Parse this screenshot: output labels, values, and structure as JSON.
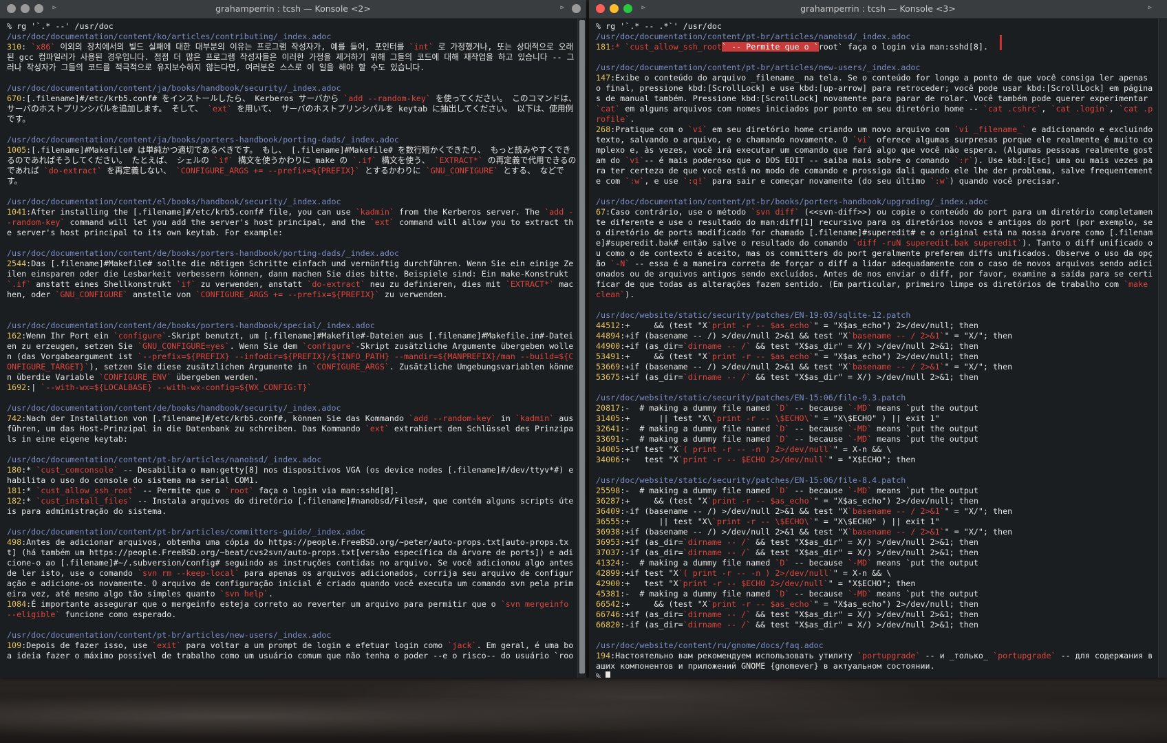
{
  "left_window": {
    "title": "grahamperrin : tcsh — Konsole <2>",
    "lines": [
      {
        "t": "prompt",
        "s": "% rg '`.* --' /usr/doc"
      },
      {
        "t": "path",
        "s": "/usr/doc/documentation/content/ko/articles/contributing/_index.adoc"
      },
      {
        "t": "match",
        "n": "310",
        "s": ": `x86` 이외의 장치에서의 빌드 실패에 대한 대부분의 이유는 프로그램 작성자가, 예를 들어, 포인터를 `int` 로 가정했거나, 또는 상대적으로 오래된 gcc 컴파일러가 사용된 경우입니다. 점점 더 많은 프로그램 작성자들은 이러한 가정을 제거하기 위해 그들의 코드에 대해 재작업을 하고 있습니다 -- 그러나 작성자가 그들의 코드를 적극적으로 유지보수하지 않는다면, 여러분은 스스로 이 일을 해야 할 수도 있습니다."
      },
      {
        "t": "blank",
        "s": ""
      },
      {
        "t": "path",
        "s": "/usr/doc/documentation/content/ja/books/handbook/security/_index.adoc"
      },
      {
        "t": "match",
        "n": "670",
        "s": ":[.filename]#/etc/krb5.conf# をインストールしたら、 Kerberos サーバから `add --random-key` を使ってください。 このコマンドは、サーバのホストプリンシパルを追加します。 そして、 `ext` を用いて、 サーバのホストプリンシパルを keytab に抽出してください。 以下は、使用例です。"
      },
      {
        "t": "blank",
        "s": ""
      },
      {
        "t": "path",
        "s": "/usr/doc/documentation/content/ja/books/porters-handbook/porting-dads/_index.adoc"
      },
      {
        "t": "match",
        "n": "1005",
        "s": ":[.filename]#Makefile# は単純かつ適切であるべきです。 もし、 [.filename]#Makefile# を数行短かくできたり、 もっと読みやすくできるのであればそうしてください。 たとえば、 シェルの `if` 構文を使うかわりに make の `.if` 構文を使う、 `EXTRACT*` の再定義で代用できるのであれば `do-extract` を再定義しない、 `CONFIGURE_ARGS += --prefix=${PREFIX}` とするかわりに `GNU_CONFIGURE` とする、 などです。"
      },
      {
        "t": "blank",
        "s": ""
      },
      {
        "t": "path",
        "s": "/usr/doc/documentation/content/el/books/handbook/security/_index.adoc"
      },
      {
        "t": "match",
        "n": "1041",
        "s": ":After installing the [.filename]#/etc/krb5.conf# file, you can use `kadmin` from the Kerberos server. The `add --random-key` command will let you add the server's host principal, and the `ext` command will allow you to extract the server's host principal to its own keytab. For example:"
      },
      {
        "t": "blank",
        "s": ""
      },
      {
        "t": "path",
        "s": "/usr/doc/documentation/content/de/books/porters-handbook/porting-dads/_index.adoc"
      },
      {
        "t": "match",
        "n": "2544",
        "s": ":Das [.filename]#Makefile# sollte die nötigen Schritte einfach und vernünftig durchführen. Wenn Sie ein einige Zeilen einsparen oder die Lesbarkeit verbessern können, dann machen Sie dies bitte. Beispiele sind: Ein make-Konstrukt `.if` anstatt eines Shellkonstrukt `if` zu verwenden, anstatt `do-extract` neu zu definieren, dies mit `EXTRACT*` machen, oder `GNU_CONFIGURE` anstelle von `CONFIGURE_ARGS += --prefix=${PREFIX}` zu verwenden."
      },
      {
        "t": "blank",
        "s": ""
      },
      {
        "t": "blank",
        "s": ""
      },
      {
        "t": "path",
        "s": "/usr/doc/documentation/content/de/books/porters-handbook/special/_index.adoc"
      },
      {
        "t": "match",
        "n": "162",
        "s": ":Wenn Ihr Port ein `configure`-Skript benutzt, um [.filename]#Makefile#-Dateien aus [.filename]#Makefile.in#-Dateien zu erzeugen, setzen Sie `GNU_CONFIGURE=yes`. Wenn Sie dem `configure`-Skript zusätzliche Argumente übergeben wollen (das Vorgabeargument ist `--prefix=${PREFIX} --infodir=${PREFIX}/${INFO_PATH} --mandir=${MANPREFIX}/man --build=${CONFIGURE_TARGET}`), setzen Sie diese zusätzlichen Argumente in `CONFIGURE_ARGS`. Zusätzliche Umgebungsvariablen können überdie Variable `CONFIGURE_ENV` übergeben werden."
      },
      {
        "t": "match",
        "n": "1692",
        "s": ":| `--with-wx=${LOCALBASE} --with-wx-config=${WX_CONFIG:T}`"
      },
      {
        "t": "blank",
        "s": ""
      },
      {
        "t": "path",
        "s": "/usr/doc/documentation/content/de/books/handbook/security/_index.adoc"
      },
      {
        "t": "match",
        "n": "742",
        "s": ":Nach der Installation von [.filename]#/etc/krb5.conf#, können Sie das Kommando `add --random-key` in `kadmin` ausführen, um das Host-Prinzipal in die Datenbank zu schreiben. Das Kommando `ext` extrahiert den Schlüssel des Prinzipals in eine eigene keytab:"
      },
      {
        "t": "blank",
        "s": ""
      },
      {
        "t": "path",
        "s": "/usr/doc/documentation/content/pt-br/articles/nanobsd/_index.adoc"
      },
      {
        "t": "match",
        "n": "180",
        "s": ":* `cust_comconsole` -- Desabilita o man:getty[8] nos dispositivos VGA (os device nodes [.filename]#/dev/ttyv*#) e habilita o uso do console do sistema na serial COM1."
      },
      {
        "t": "match",
        "n": "181",
        "s": ":* `cust_allow_ssh_root` -- Permite que o `root` faça o login via man:sshd[8]."
      },
      {
        "t": "match",
        "n": "182",
        "s": ":* `cust_install_files` -- Instala arquivos do diretório [.filename]#nanobsd/Files#, que contém alguns scripts úteis para administração do sistema."
      },
      {
        "t": "blank",
        "s": ""
      },
      {
        "t": "path",
        "s": "/usr/doc/documentation/content/pt-br/articles/committers-guide/_index.adoc"
      },
      {
        "t": "match",
        "n": "498",
        "s": ":Antes de adicionar arquivos, obtenha uma cópia do https://people.FreeBSD.org/~peter/auto-props.txt[auto-props.txt] (há também um https://people.FreeBSD.org/~beat/cvs2svn/auto-props.txt[versão específica da árvore de ports]) e adicione-o ao [.filename]#~/.subversion/config# seguindo as instruções contidas no arquivo. Se você adicionou algo antes de ler isto, use o comando `svn rm --keep-local` para apenas os arquivos adicionados, corrija seu arquivo de configuração e adicione-os novamente. O arquivo de configuração inicial é criado quando você executa um comando svn pela primeira vez, até mesmo algo tão simples quanto `svn help`."
      },
      {
        "t": "match",
        "n": "1084",
        "s": ":É importante assegurar que o mergeinfo esteja correto ao reverter um arquivo para permitir que o `svn mergeinfo --eligible` funcione como esperado."
      },
      {
        "t": "blank",
        "s": ""
      },
      {
        "t": "path",
        "s": "/usr/doc/documentation/content/pt-br/articles/new-users/_index.adoc"
      },
      {
        "t": "match",
        "n": "109",
        "s": ":Depois de fazer isso, use `exit` para voltar a um prompt de login e efetuar login como `jack`. Em geral, é uma boa ideia fazer o máximo possível de trabalho como um usuário comum que não tenha o poder --e o risco-- do usuário `roo"
      }
    ]
  },
  "right_window": {
    "title": "grahamperrin : tcsh — Konsole <3>",
    "lines": [
      {
        "t": "prompt",
        "s": "% rg '`.* -- .*`' /usr/doc"
      },
      {
        "t": "path",
        "s": "/usr/doc/documentation/content/pt-br/articles/nanobsd/_index.adoc"
      },
      {
        "t": "sel",
        "n": "181",
        "a": ":* `cust_allow_ssh_root",
        "b": "` -- Permite que o `",
        "c": "root` faça o login via man:sshd[8]."
      },
      {
        "t": "blank",
        "s": ""
      },
      {
        "t": "path",
        "s": "/usr/doc/documentation/content/pt-br/articles/new-users/_index.adoc"
      },
      {
        "t": "match",
        "n": "147",
        "s": ":Exibe o conteúdo do arquivo _filename_ na tela. Se o conteúdo for longo a ponto de que você consiga ler apenas o final, pressione kbd:[ScrollLock] e use kbd:[up-arrow] para retroceder; você pode usar kbd:[ScrollLock] em páginas de manual também. Pressione kbd:[ScrollLock] novamente para parar de rolar. Você também pode querer experimentar `cat` em alguns arquivos com nomes iniciados por ponto em seu diretório home -- `cat .cshrc`, `cat .login`, `cat .profile`."
      },
      {
        "t": "match",
        "n": "268",
        "s": ":Pratique com o `vi` em seu diretório home criando um novo arquivo com `vi _filename_` e adicionando e excluindo texto, salvando o arquivo, e o chamando novamente. O `vi` oferece algumas surpresas porque ele realmente é muito complexo e, às vezes, você irá executar um comando que fará algo que você não espera. (Algumas pessoas realmente gostam do `vi`-- é mais poderoso que o DOS EDIT -- saiba mais sobre o comando `:r`). Use kbd:[Esc] uma ou mais vezes para ter certeza de que você está no modo de comando e prossiga dali quando ele lhe der problema, salve frequentemente com `:w`, e use `:q!` para sair e começar novamente (do seu último `:w`) quando você precisar."
      },
      {
        "t": "blank",
        "s": ""
      },
      {
        "t": "path",
        "s": "/usr/doc/documentation/content/pt-br/books/porters-handbook/upgrading/_index.adoc"
      },
      {
        "t": "match",
        "n": "67",
        "s": ":Caso contrário, use o método `svn diff` (<<svn-diff>>) ou copie o conteúdo do port para um diretório completamente diferente e use o resultado do man:diff[1] recursivo para os diretórios novos e antigos do port (por exemplo, se o diretório de ports modificado for chamado [.filename]#superedit# e o original está na nossa árvore como [.filename]#superedit.bak# então salve o resultado do comando `diff -ruN superedit.bak superedit`). Tanto o diff unificado ou como o de contexto é aceito, mas os committers do port geralmente preferem diffs unificados. Observe o uso da opção `-N` -- essa é a maneira correta de forçar o diff a lidar adequadamente com o caso de novos arquivos sendo adicionados ou de arquivos antigos sendo excluídos. Antes de nos enviar o diff, por favor, examine a saída para se certificar de que todas as alterações fazem sentido. (Em particular, primeiro limpe os diretórios de trabalho com `make clean`)."
      },
      {
        "t": "blank",
        "s": ""
      },
      {
        "t": "path",
        "s": "/usr/doc/website/static/security/patches/EN-19:03/sqlite-12.patch"
      },
      {
        "t": "match",
        "n": "44512",
        "s": ":+     && (test \"X`print -r -- $as_echo`\" = \"X$as_echo\") 2>/dev/null; then"
      },
      {
        "t": "match",
        "n": "44894",
        "s": ":+if (basename -- /) >/dev/null 2>&1 && test \"X`basename -- / 2>&1`\" = \"X/\"; then"
      },
      {
        "t": "match",
        "n": "44900",
        "s": ":+if (as_dir=`dirname -- /` && test \"X$as_dir\" = X/) >/dev/null 2>&1; then"
      },
      {
        "t": "match",
        "n": "53491",
        "s": ":+     && (test \"X`print -r -- $as_echo`\" = \"X$as_echo\") 2>/dev/null; then"
      },
      {
        "t": "match",
        "n": "53669",
        "s": ":+if (basename -- /) >/dev/null 2>&1 && test \"X`basename -- / 2>&1`\" = \"X/\"; then"
      },
      {
        "t": "match",
        "n": "53675",
        "s": ":+if (as_dir=`dirname -- /` && test \"X$as_dir\" = X/) >/dev/null 2>&1; then"
      },
      {
        "t": "blank",
        "s": ""
      },
      {
        "t": "path",
        "s": "/usr/doc/website/static/security/patches/EN-15:06/file-9.3.patch"
      },
      {
        "t": "match",
        "n": "20817",
        "s": ":-  # making a dummy file named `D` -- because `-MD` means `put the output"
      },
      {
        "t": "match",
        "n": "31405",
        "s": ":+      || test \"X\\`print -r -- \\$ECHO\\`\" = \"X\\$ECHO\" ) || exit 1\""
      },
      {
        "t": "match",
        "n": "32641",
        "s": ":-  # making a dummy file named `D` -- because `-MD` means `put the output"
      },
      {
        "t": "match",
        "n": "33691",
        "s": ":-  # making a dummy file named `D` -- because `-MD` means `put the output"
      },
      {
        "t": "match",
        "n": "34005",
        "s": ":+if test \"X`( print -r -- -n ) 2>/dev/null`\" = X-n && \\"
      },
      {
        "t": "match",
        "n": "34006",
        "s": ":+   test \"X`print -r -- $ECHO 2>/dev/null`\" = \"X$ECHO\"; then"
      },
      {
        "t": "blank",
        "s": ""
      },
      {
        "t": "path",
        "s": "/usr/doc/website/static/security/patches/EN-15:06/file-8.4.patch"
      },
      {
        "t": "match",
        "n": "25598",
        "s": ":-  # making a dummy file named `D` -- because `-MD` means `put the output"
      },
      {
        "t": "match",
        "n": "36287",
        "s": ":+     && (test \"X`print -r -- $as_echo`\" = \"X$as_echo\") 2>/dev/null; then"
      },
      {
        "t": "match",
        "n": "36409",
        "s": ":-if (basename -- /) >/dev/null 2>&1 && test \"X`basename -- / 2>&1`\" = \"X/\"; then"
      },
      {
        "t": "match",
        "n": "36555",
        "s": ":+      || test \"X\\`print -r -- \\$ECHO\\`\" = \"X\\$ECHO\" ) || exit 1\""
      },
      {
        "t": "match",
        "n": "36938",
        "s": ":+if (basename -- /) >/dev/null 2>&1 && test \"X`basename -- / 2>&1`\" = \"X/\"; then"
      },
      {
        "t": "match",
        "n": "36953",
        "s": ":+if (as_dir=`dirname -- /` && test \"X$as_dir\" = X/) >/dev/null 2>&1; then"
      },
      {
        "t": "match",
        "n": "37037",
        "s": ":-if (as_dir=`dirname -- /` && test \"X$as_dir\" = X/) >/dev/null 2>&1; then"
      },
      {
        "t": "match",
        "n": "41324",
        "s": ":-  # making a dummy file named `D` -- because `-MD` means `put the output"
      },
      {
        "t": "match",
        "n": "42899",
        "s": ":+if test \"X`( print -r -- -n ) 2>/dev/null`\" = X-n && \\"
      },
      {
        "t": "match",
        "n": "42900",
        "s": ":+   test \"X`print -r -- $ECHO 2>/dev/null`\" = \"X$ECHO\"; then"
      },
      {
        "t": "match",
        "n": "45381",
        "s": ":-  # making a dummy file named `D` -- because `-MD` means `put the output"
      },
      {
        "t": "match",
        "n": "66542",
        "s": ":+     && (test \"X`print -r -- $as_echo`\" = \"X$as_echo\") 2>/dev/null; then"
      },
      {
        "t": "match",
        "n": "66746",
        "s": ":+if (as_dir=`dirname -- /` && test \"X$as_dir\" = X/) >/dev/null 2>&1; then"
      },
      {
        "t": "match",
        "n": "66820",
        "s": ":-if (as_dir=`dirname -- /` && test \"X$as_dir\" = X/) >/dev/null 2>&1; then"
      },
      {
        "t": "blank",
        "s": ""
      },
      {
        "t": "path",
        "s": "/usr/doc/website/content/ru/gnome/docs/faq.adoc"
      },
      {
        "t": "match",
        "n": "194",
        "s": ":Настоятельно вам рекомендуем использовать утилиту `portupgrade` -- и _только_ `portupgrade` -- для содержания ваших компонентов и приложений GNOME {gnomever} в актуальном состоянии."
      },
      {
        "t": "cursor",
        "s": "% "
      }
    ]
  },
  "colors": {
    "path": "#7a8cc6",
    "linenum": "#e8c25a",
    "match": "#e0443c",
    "text": "#e6e6e6",
    "bg": "#1b1e20"
  }
}
